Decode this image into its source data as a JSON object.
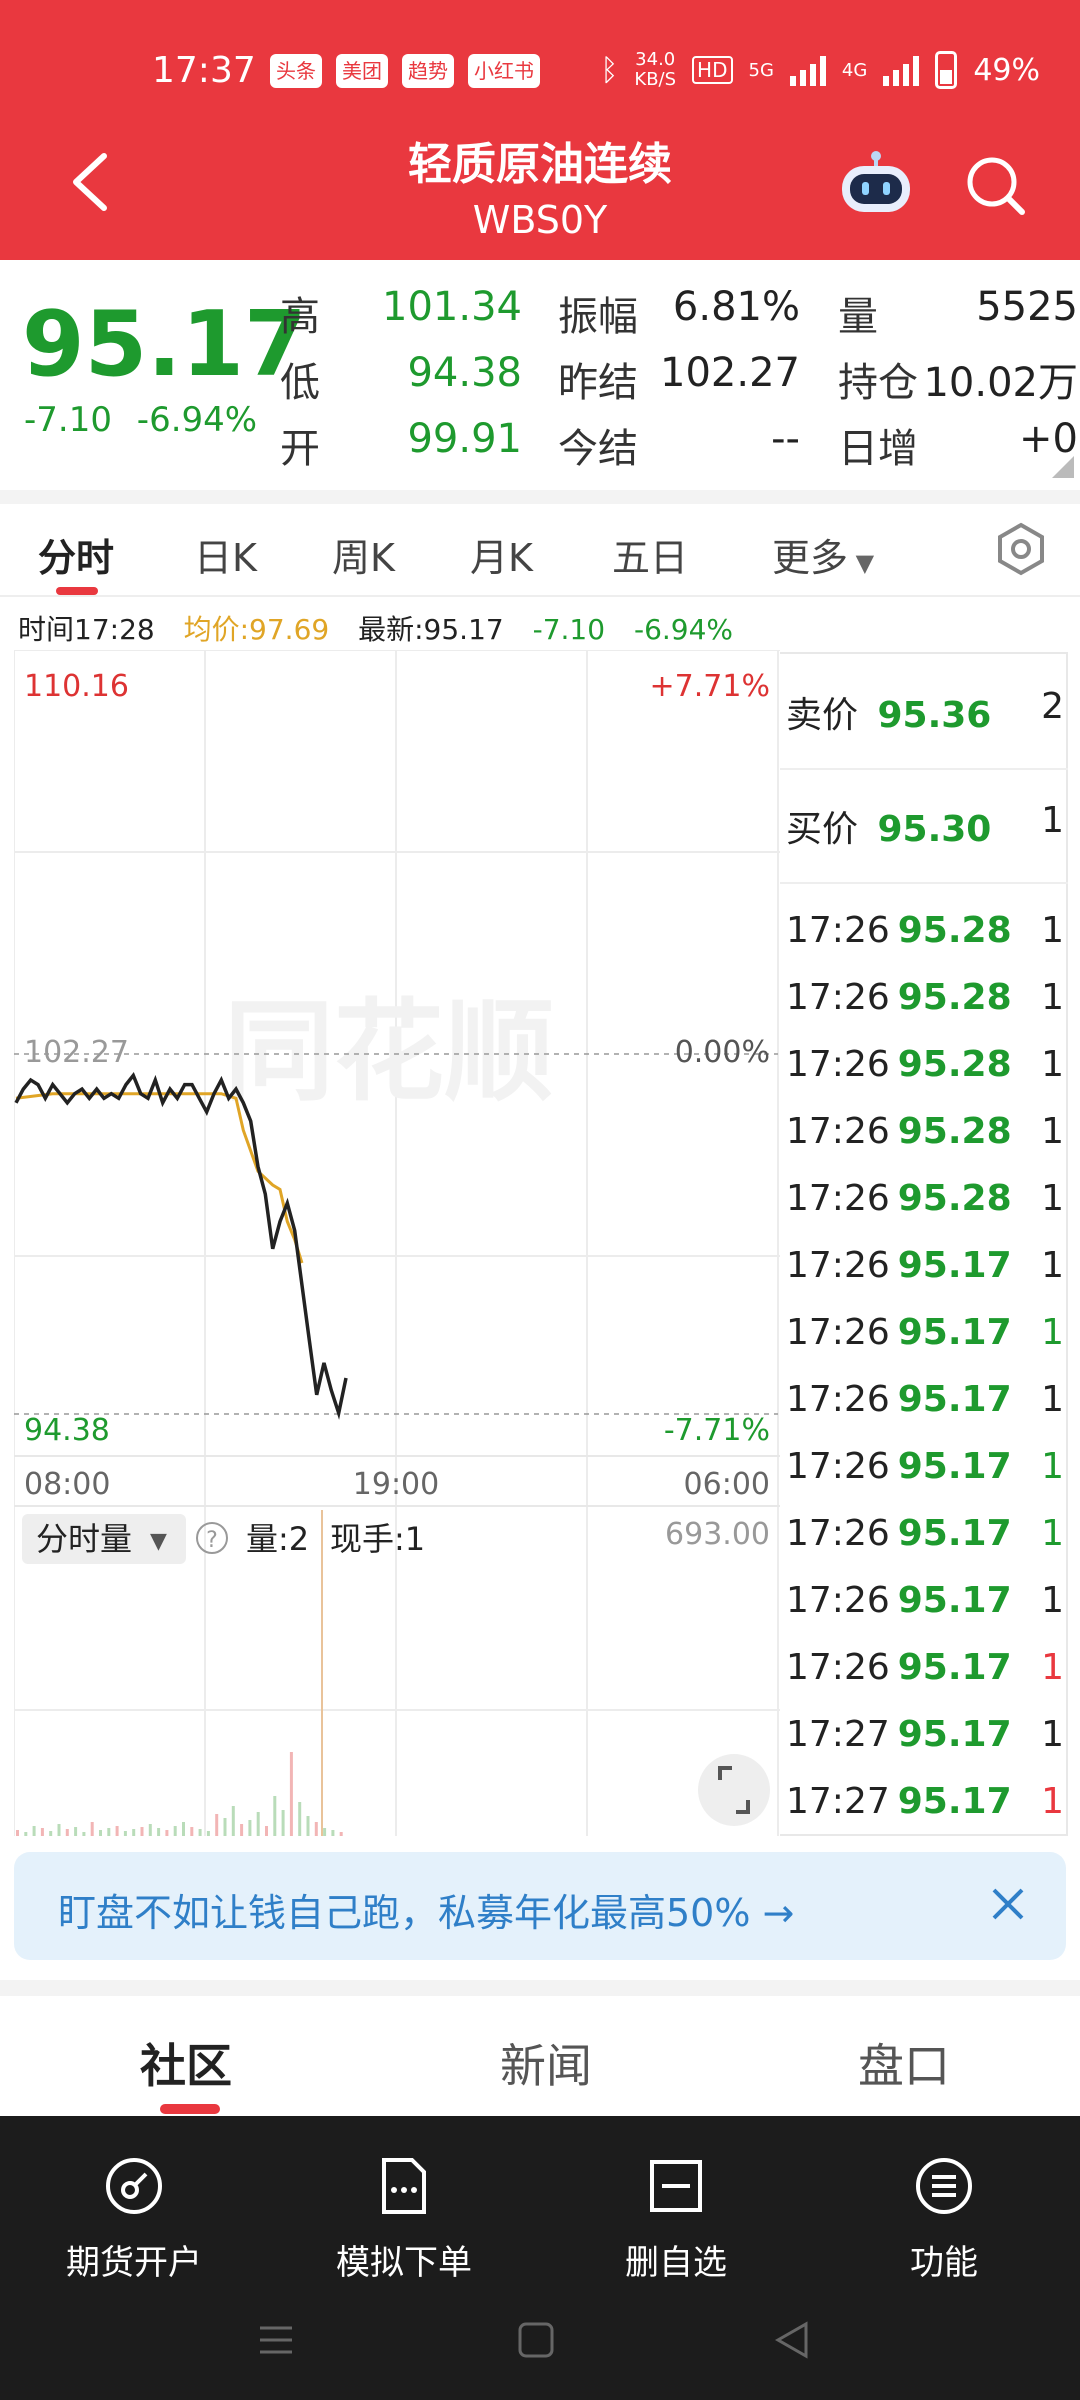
{
  "status_bar": {
    "time": "17:37",
    "apps": [
      "头条",
      "美团",
      "趋势",
      "小红书"
    ],
    "network_speed": "34.0",
    "network_unit": "KB/S",
    "hd": "HD",
    "net1": "5G",
    "net2": "4G",
    "battery": "49%"
  },
  "header": {
    "title": "轻质原油连续",
    "subtitle": "WBS0Y"
  },
  "quote": {
    "price": "95.17",
    "change": "-7.10",
    "change_pct": "-6.94%",
    "stats": [
      {
        "label": "高",
        "value": "101.34"
      },
      {
        "label": "低",
        "value": "94.38"
      },
      {
        "label": "开",
        "value": "99.91"
      },
      {
        "label": "振幅",
        "value": "6.81%"
      },
      {
        "label": "昨结",
        "value": "102.27"
      },
      {
        "label": "今结",
        "value": "--"
      },
      {
        "label": "量",
        "value": "5525"
      },
      {
        "label": "持仓",
        "value": "10.02万"
      },
      {
        "label": "日增",
        "value": "+0"
      }
    ]
  },
  "tabs": [
    "分时",
    "日K",
    "周K",
    "月K",
    "五日",
    "更多"
  ],
  "info_bar": {
    "time": "时间17:28",
    "avg": "均价:97.69",
    "last": "最新:95.17",
    "chg": "-7.10",
    "pct": "-6.94%"
  },
  "chart_data": {
    "type": "line",
    "y_top_label": "110.16",
    "y_mid_label": "102.27",
    "y_bottom_label": "94.38",
    "pct_top": "+7.71%",
    "pct_mid": "0.00%",
    "pct_bottom": "-7.71%",
    "x_labels": [
      "08:00",
      "19:00",
      "06:00"
    ],
    "ylim": [
      94.38,
      110.16
    ],
    "series": [],
    "price_line": [
      [
        0,
        101.2
      ],
      [
        2,
        101.5
      ],
      [
        4,
        101.7
      ],
      [
        6,
        101.6
      ],
      [
        8,
        101.3
      ],
      [
        10,
        101.6
      ],
      [
        12,
        101.4
      ],
      [
        14,
        101.2
      ],
      [
        16,
        101.4
      ],
      [
        18,
        101.5
      ],
      [
        20,
        101.3
      ],
      [
        22,
        101.5
      ],
      [
        24,
        101.3
      ],
      [
        26,
        101.4
      ],
      [
        28,
        101.3
      ],
      [
        30,
        101.6
      ],
      [
        32,
        101.8
      ],
      [
        34,
        101.4
      ],
      [
        36,
        101.3
      ],
      [
        38,
        101.7
      ],
      [
        40,
        101.2
      ],
      [
        42,
        101.5
      ],
      [
        44,
        101.3
      ],
      [
        46,
        101.6
      ],
      [
        48,
        101.6
      ],
      [
        50,
        101.3
      ],
      [
        52,
        101.0
      ],
      [
        54,
        101.4
      ],
      [
        56,
        101.7
      ],
      [
        58,
        101.3
      ],
      [
        60,
        101.5
      ],
      [
        62,
        101.2
      ],
      [
        64,
        100.8
      ],
      [
        66,
        99.8
      ],
      [
        68,
        99.2
      ],
      [
        70,
        98.0
      ],
      [
        72,
        98.6
      ],
      [
        74,
        99.0
      ],
      [
        76,
        98.4
      ],
      [
        78,
        97.2
      ],
      [
        80,
        96.0
      ],
      [
        82,
        94.8
      ],
      [
        84,
        95.5
      ],
      [
        86,
        94.9
      ],
      [
        88,
        94.4
      ],
      [
        90,
        95.17
      ]
    ],
    "avg_line": [
      [
        0,
        101.3
      ],
      [
        10,
        101.4
      ],
      [
        20,
        101.4
      ],
      [
        30,
        101.4
      ],
      [
        40,
        101.4
      ],
      [
        50,
        101.4
      ],
      [
        56,
        101.4
      ],
      [
        60,
        101.3
      ],
      [
        62,
        100.6
      ],
      [
        66,
        99.7
      ],
      [
        70,
        99.4
      ],
      [
        72,
        99.3
      ],
      [
        74,
        98.6
      ],
      [
        76,
        98.2
      ],
      [
        78,
        97.69
      ]
    ],
    "volume_max": "693.00",
    "volume_label": "分时量",
    "volume_qty": "量:2",
    "volume_now": "现手:1"
  },
  "orderbook": {
    "ask": {
      "label": "卖价",
      "price": "95.36",
      "vol": "2"
    },
    "bid": {
      "label": "买价",
      "price": "95.30",
      "vol": "1"
    },
    "ticks": [
      {
        "t": "17:26",
        "p": "95.28",
        "v": "1",
        "c": "k"
      },
      {
        "t": "17:26",
        "p": "95.28",
        "v": "1",
        "c": "k"
      },
      {
        "t": "17:26",
        "p": "95.28",
        "v": "1",
        "c": "k"
      },
      {
        "t": "17:26",
        "p": "95.28",
        "v": "1",
        "c": "k"
      },
      {
        "t": "17:26",
        "p": "95.28",
        "v": "1",
        "c": "k"
      },
      {
        "t": "17:26",
        "p": "95.17",
        "v": "1",
        "c": "k"
      },
      {
        "t": "17:26",
        "p": "95.17",
        "v": "1",
        "c": "g"
      },
      {
        "t": "17:26",
        "p": "95.17",
        "v": "1",
        "c": "k"
      },
      {
        "t": "17:26",
        "p": "95.17",
        "v": "1",
        "c": "g"
      },
      {
        "t": "17:26",
        "p": "95.17",
        "v": "1",
        "c": "g"
      },
      {
        "t": "17:26",
        "p": "95.17",
        "v": "1",
        "c": "k"
      },
      {
        "t": "17:26",
        "p": "95.17",
        "v": "1",
        "c": "r"
      },
      {
        "t": "17:27",
        "p": "95.17",
        "v": "1",
        "c": "k"
      },
      {
        "t": "17:27",
        "p": "95.17",
        "v": "1",
        "c": "r"
      }
    ]
  },
  "banner": {
    "text": "盯盘不如让钱自己跑，私募年化最高50% →"
  },
  "bottom_tabs": [
    "社区",
    "新闻",
    "盘口"
  ],
  "toolbar": [
    {
      "label": "期货开户",
      "icon": "compass-icon"
    },
    {
      "label": "模拟下单",
      "icon": "document-icon"
    },
    {
      "label": "删自选",
      "icon": "minus-square-icon"
    },
    {
      "label": "功能",
      "icon": "menu-circle-icon"
    }
  ],
  "colors": {
    "brand_red": "#e9383f",
    "down_green": "#1e9a2e",
    "avg_line": "#e0a526",
    "banner_blue": "#2f7fc8"
  }
}
